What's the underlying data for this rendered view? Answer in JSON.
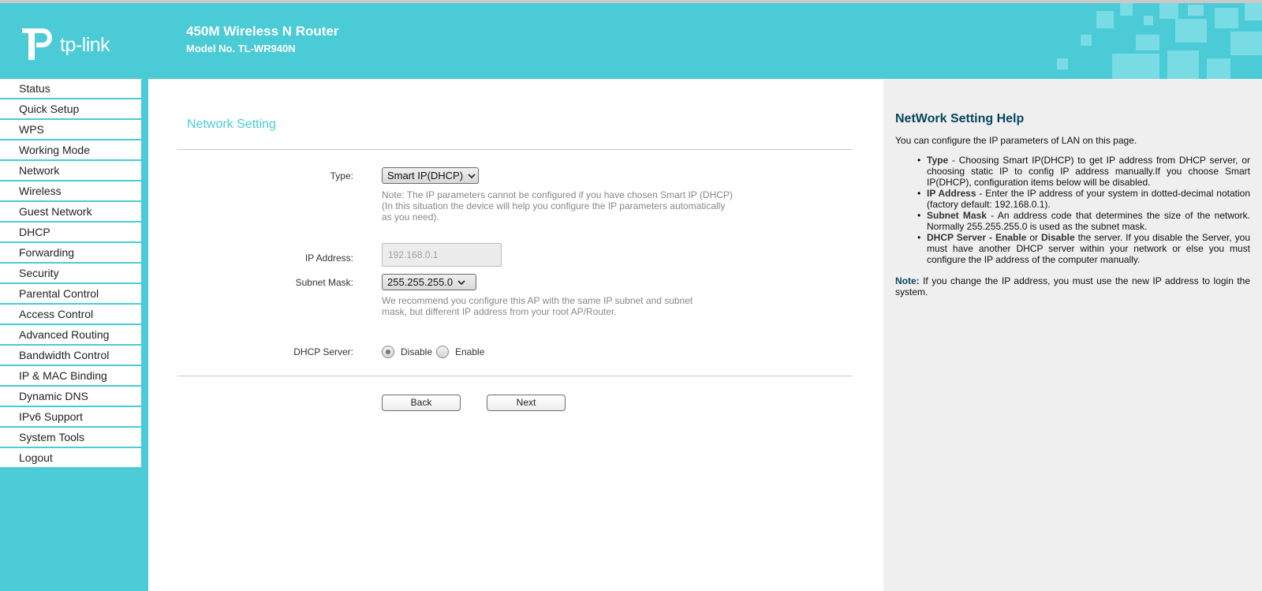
{
  "header": {
    "logo_text": "tp-link",
    "product_name": "450M Wireless N Router",
    "model": "Model No. TL-WR940N"
  },
  "sidebar": {
    "items": [
      {
        "label": "Status"
      },
      {
        "label": "Quick Setup"
      },
      {
        "label": "WPS"
      },
      {
        "label": "Working Mode"
      },
      {
        "label": "Network"
      },
      {
        "label": "Wireless"
      },
      {
        "label": "Guest Network"
      },
      {
        "label": "DHCP"
      },
      {
        "label": "Forwarding"
      },
      {
        "label": "Security"
      },
      {
        "label": "Parental Control"
      },
      {
        "label": "Access Control"
      },
      {
        "label": "Advanced Routing"
      },
      {
        "label": "Bandwidth Control"
      },
      {
        "label": "IP & MAC Binding"
      },
      {
        "label": "Dynamic DNS"
      },
      {
        "label": "IPv6 Support"
      },
      {
        "label": "System Tools"
      },
      {
        "label": "Logout"
      }
    ]
  },
  "main": {
    "title": "Network Setting",
    "type_label": "Type:",
    "type_value": "Smart IP(DHCP)",
    "type_note_1": "Note: The IP parameters cannot be configured if you have chosen Smart IP (DHCP)",
    "type_note_2": "(In this situation the device will help you configure the IP parameters automatically",
    "type_note_3": "as you need).",
    "ip_label": "IP Address:",
    "ip_value": "192.168.0.1",
    "mask_label": "Subnet Mask:",
    "mask_value": "255.255.255.0",
    "mask_note_1": "We recommend you configure this AP with the same IP subnet and subnet",
    "mask_note_2": "mask, but different IP address from your root AP/Router.",
    "dhcp_label": "DHCP Server:",
    "dhcp_options": [
      "Disable",
      "Enable"
    ],
    "dhcp_selected": "Disable",
    "back_label": "Back",
    "next_label": "Next"
  },
  "help": {
    "title": "NetWork Setting Help",
    "intro": "You can configure the IP parameters of LAN on this page.",
    "items": [
      {
        "term": "Type",
        "text": " - Choosing Smart IP(DHCP) to get IP address from DHCP server, or choosing static IP to config IP address manually.If you choose Smart IP(DHCP), configuration items below will be disabled."
      },
      {
        "term": "IP Address",
        "text": " - Enter the IP address of your system in dotted-decimal notation (factory default: 192.168.0.1)."
      },
      {
        "term": "Subnet Mask",
        "text": " - An address code that determines the size of the network. Normally 255.255.255.0 is used as the subnet mask."
      },
      {
        "term": "DHCP Server",
        "text_1": " - ",
        "term_2": "Enable",
        "text_2": " or ",
        "term_3": "Disable",
        "text": " the server. If you disable the Server, you must have another DHCP server within your network or else you must configure the IP address of the computer manually."
      }
    ],
    "note_label": "Note:",
    "note_text": " If you change the IP address, you must use the new IP address to login the system."
  },
  "colors": {
    "brand_teal": "#4acbd6",
    "help_title": "#08465f"
  }
}
